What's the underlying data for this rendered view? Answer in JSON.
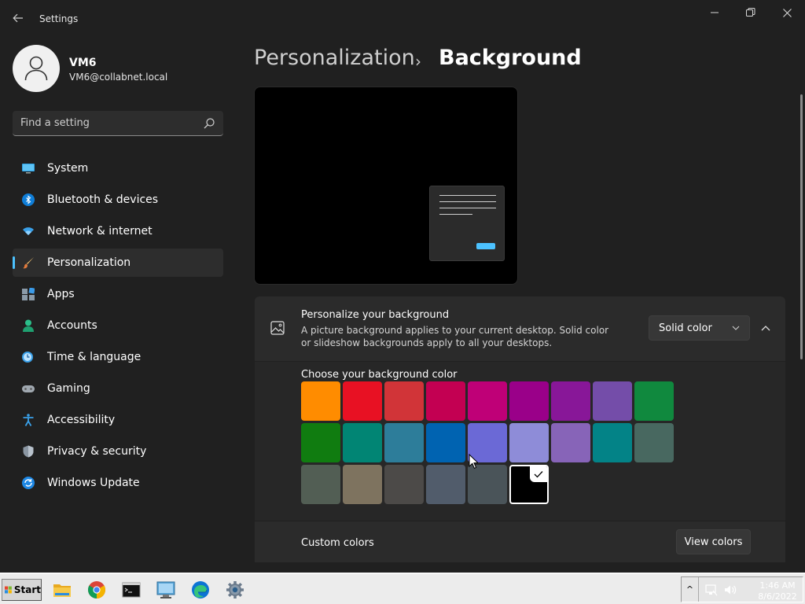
{
  "window": {
    "title": "Settings",
    "back_icon": "back-arrow-icon",
    "controls": [
      "minimize-icon",
      "maximize-icon",
      "close-icon"
    ]
  },
  "profile": {
    "name": "VM6",
    "email": "VM6@collabnet.local"
  },
  "search": {
    "placeholder": "Find a setting",
    "value": ""
  },
  "sidebar": {
    "items": [
      {
        "label": "System",
        "icon": "monitor-icon",
        "active": false
      },
      {
        "label": "Bluetooth & devices",
        "icon": "bluetooth-icon",
        "active": false
      },
      {
        "label": "Network & internet",
        "icon": "wifi-icon",
        "active": false
      },
      {
        "label": "Personalization",
        "icon": "brush-icon",
        "active": true
      },
      {
        "label": "Apps",
        "icon": "apps-icon",
        "active": false
      },
      {
        "label": "Accounts",
        "icon": "person-icon",
        "active": false
      },
      {
        "label": "Time & language",
        "icon": "clock-globe-icon",
        "active": false
      },
      {
        "label": "Gaming",
        "icon": "gamepad-icon",
        "active": false
      },
      {
        "label": "Accessibility",
        "icon": "accessibility-icon",
        "active": false
      },
      {
        "label": "Privacy & security",
        "icon": "shield-icon",
        "active": false
      },
      {
        "label": "Windows Update",
        "icon": "update-icon",
        "active": false
      }
    ]
  },
  "header": {
    "parent": "Personalization",
    "separator": "›",
    "current": "Background"
  },
  "background_card": {
    "title": "Personalize your background",
    "description": "A picture background applies to your current desktop. Solid color or slideshow backgrounds apply to all your desktops.",
    "dropdown_value": "Solid color",
    "icon": "picture-icon"
  },
  "colors": {
    "title": "Choose your background color",
    "swatches": [
      [
        "#FF8C00",
        "#E81123",
        "#D13438",
        "#C30052",
        "#BF0077",
        "#9A0089",
        "#881798",
        "#744DA9",
        "#10893E"
      ],
      [
        "#107C10",
        "#018574",
        "#2D7D9A",
        "#0063B1",
        "#6B69D6",
        "#8E8CD8",
        "#8764B8",
        "#038387",
        "#486860"
      ],
      [
        "#525E54",
        "#7E735F",
        "#4C4A48",
        "#515C6B",
        "#4A5459",
        "#000000"
      ]
    ],
    "selected": "#000000"
  },
  "custom_colors": {
    "label": "Custom colors",
    "button": "View colors"
  },
  "taskbar": {
    "start_label": "Start",
    "pinned": [
      "file-explorer-icon",
      "chrome-icon",
      "terminal-icon",
      "remote-desktop-icon",
      "edge-icon",
      "settings-gear-icon"
    ],
    "tray_expand": "^",
    "time": "1:46 AM",
    "date": "8/6/2022"
  }
}
